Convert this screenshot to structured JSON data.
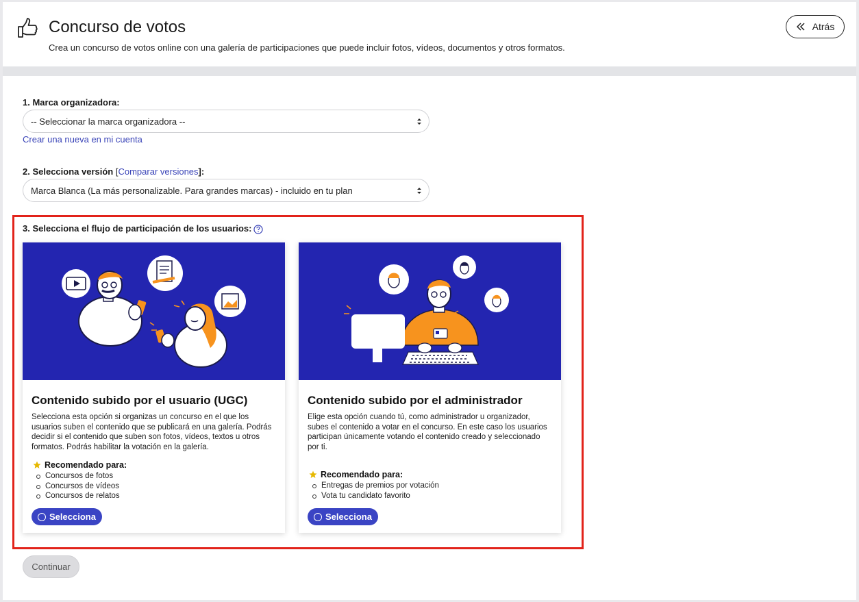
{
  "header": {
    "title": "Concurso de votos",
    "subtitle": "Crea un concurso de votos online con una galería de participaciones que puede incluir fotos, vídeos, documentos y otros formatos.",
    "back_label": "Atrás",
    "icon": "thumbs-up-icon"
  },
  "step1": {
    "label": "1. Marca organizadora:",
    "select_value": "-- Seleccionar la marca organizadora --",
    "create_link": "Crear una nueva en mi cuenta"
  },
  "step2": {
    "label": "2. Selecciona versión",
    "bracket_open": "[",
    "compare_link": "Comparar versiones",
    "bracket_close": "]:",
    "select_value": "Marca Blanca (La más personalizable. Para grandes marcas) - incluido en tu plan"
  },
  "step3": {
    "label": "3. Selecciona el flujo de participación de los usuarios:"
  },
  "cards": [
    {
      "title": "Contenido subido por el usuario (UGC)",
      "description": "Selecciona esta opción si organizas un concurso en el que los usuarios suben el contenido que se publicará en una galería. Podrás decidir si el contenido que suben son fotos, vídeos, textos u otros formatos. Podrás habilitar la votación en la galería.",
      "recommended_label": "Recomendado para:",
      "recommended": [
        "Concursos de fotos",
        "Concursos de vídeos",
        "Concursos de relatos"
      ],
      "button_label": "Selecciona"
    },
    {
      "title": "Contenido subido por el administrador",
      "description": "Elige esta opción cuando tú, como administrador u organizador, subes el contenido a votar en el concurso. En este caso los usuarios participan únicamente votando el contenido creado y seleccionado por ti.",
      "recommended_label": "Recomendado para:",
      "recommended": [
        "Entregas de premios por votación",
        "Vota tu candidato favorito"
      ],
      "button_label": "Selecciona"
    }
  ],
  "footer": {
    "continue_label": "Continuar"
  },
  "colors": {
    "accent": "#3a44c4",
    "illustration_bg": "#2325b0",
    "highlight": "#e2231a",
    "orange": "#f7931e"
  }
}
